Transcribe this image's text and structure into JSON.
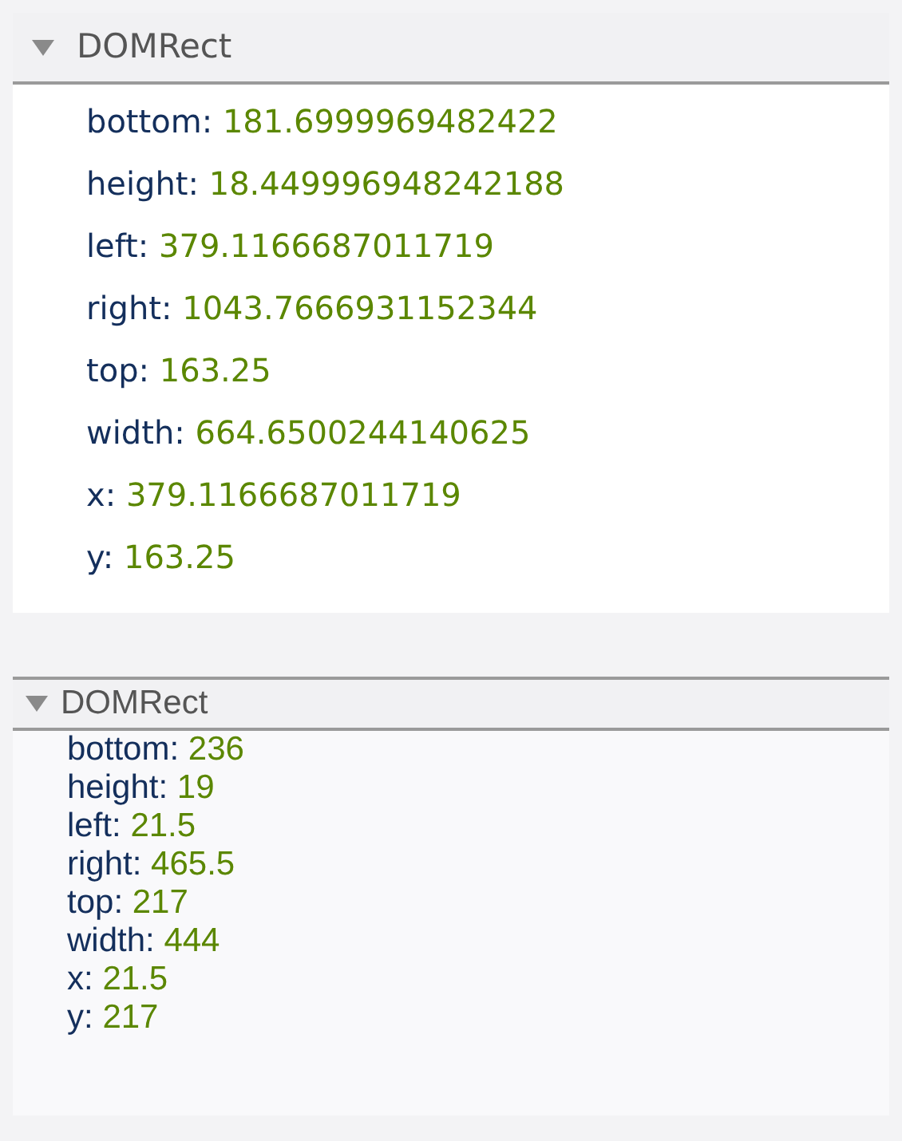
{
  "panels": [
    {
      "kind": "large",
      "title": "DOMRect",
      "expanded": true,
      "properties": [
        {
          "key": "bottom:",
          "value": "181.6999969482422"
        },
        {
          "key": "height:",
          "value": "18.449996948242188"
        },
        {
          "key": "left:",
          "value": "379.1166687011719"
        },
        {
          "key": "right:",
          "value": "1043.7666931152344"
        },
        {
          "key": "top:",
          "value": "163.25"
        },
        {
          "key": "width:",
          "value": "664.6500244140625"
        },
        {
          "key": "x:",
          "value": "379.1166687011719"
        },
        {
          "key": "y:",
          "value": "163.25"
        }
      ]
    },
    {
      "kind": "compact",
      "title": "DOMRect",
      "expanded": true,
      "properties": [
        {
          "key": "bottom:",
          "value": "236"
        },
        {
          "key": "height:",
          "value": "19"
        },
        {
          "key": "left:",
          "value": "21.5"
        },
        {
          "key": "right:",
          "value": "465.5"
        },
        {
          "key": "top:",
          "value": "217"
        },
        {
          "key": "width:",
          "value": "444"
        },
        {
          "key": "x:",
          "value": "21.5"
        },
        {
          "key": "y:",
          "value": "217"
        }
      ]
    }
  ]
}
